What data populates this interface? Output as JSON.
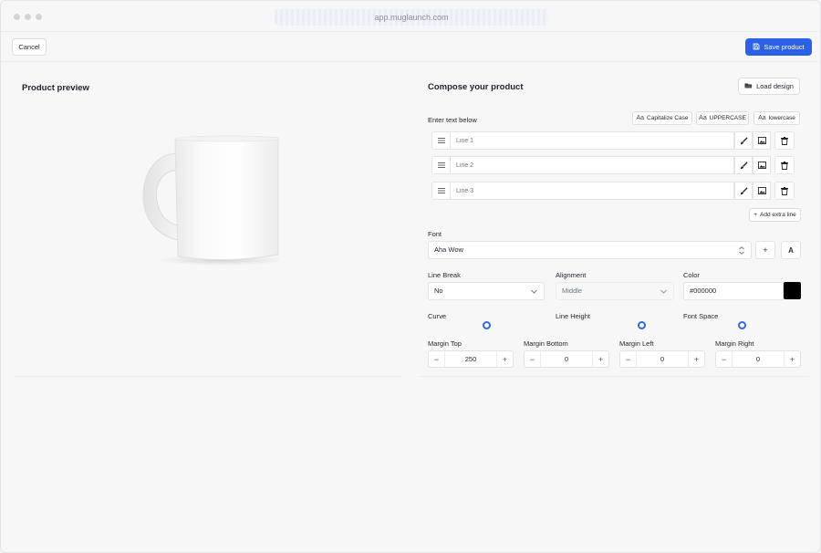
{
  "browser": {
    "url": "app.muglaunch.com"
  },
  "toolbar": {
    "cancel_label": "Cancel",
    "save_label": "Save product"
  },
  "preview": {
    "title": "Product preview"
  },
  "compose": {
    "title": "Compose your product",
    "load_label": "Load design",
    "enter_text_label": "Enter text below",
    "case_buttons": [
      "Capitalize Case",
      "UPPERCASE",
      "lowercase"
    ],
    "case_icon_text": "Aa",
    "lines": [
      {
        "placeholder": "Line 1"
      },
      {
        "placeholder": "Line 2"
      },
      {
        "placeholder": "Line 3"
      }
    ],
    "add_line_label": "Add extra line",
    "font_label": "Font",
    "font_value": "Aha Wow",
    "font_glyph": "A",
    "line_break_label": "Line Break",
    "line_break_value": "No",
    "alignment_label": "Alignment",
    "alignment_value": "Middle",
    "color_label": "Color",
    "color_value": "#000000",
    "curve_label": "Curve",
    "line_height_label": "Line Height",
    "font_space_label": "Font Space",
    "margin_top_label": "Margin Top",
    "margin_top_value": "250",
    "margin_bottom_label": "Margin Bottom",
    "margin_bottom_value": "0",
    "margin_left_label": "Margin Left",
    "margin_left_value": "0",
    "margin_right_label": "Margin Right",
    "margin_right_value": "0"
  },
  "colors": {
    "accent": "#2b62e5",
    "slider_knob": "#3366e0",
    "swatch": "#000000"
  },
  "icons": {
    "save": "save-icon",
    "load": "folder-open-icon",
    "drag": "drag-handle-icon",
    "brush": "brush-icon",
    "image": "image-icon",
    "trash": "trash-icon",
    "plus": "plus-icon",
    "chevron": "chevron-down-icon",
    "updown": "chevron-updown-icon"
  }
}
